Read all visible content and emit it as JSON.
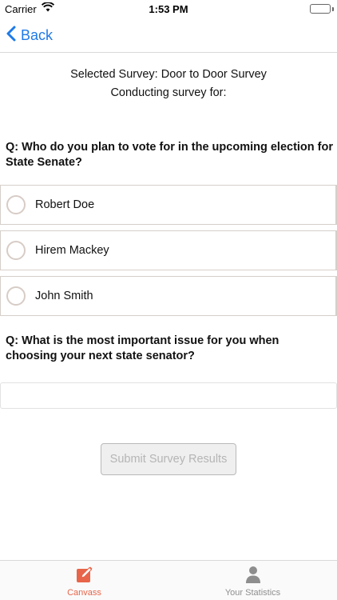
{
  "status_bar": {
    "carrier": "Carrier",
    "time": "1:53 PM",
    "battery_level": 1.0,
    "wifi_icon": "wifi-icon",
    "battery_color": "#4cd964"
  },
  "nav": {
    "back_label": "Back",
    "back_icon": "chevron-left-icon",
    "accent_color": "#1e7ae8"
  },
  "survey": {
    "selected_line": "Selected Survey: Door to Door Survey",
    "conducting_line": "Conducting survey for:"
  },
  "questions": [
    {
      "text": "Q: Who do you plan to vote for in the upcoming election for State Senate?",
      "options": [
        "Robert Doe",
        "Hirem Mackey",
        "John Smith"
      ]
    },
    {
      "text": "Q: What is the most important issue for you when choosing your next state senator?",
      "answer_value": "",
      "answer_placeholder": ""
    }
  ],
  "submit": {
    "label": "Submit Survey Results",
    "enabled": false
  },
  "tab_bar": {
    "tabs": [
      {
        "label": "Canvass",
        "icon": "pencil-square-icon",
        "selected": true,
        "color": "#e8654a"
      },
      {
        "label": "Your Statistics",
        "icon": "person-icon",
        "selected": false,
        "color": "#8e8e8e"
      }
    ]
  }
}
